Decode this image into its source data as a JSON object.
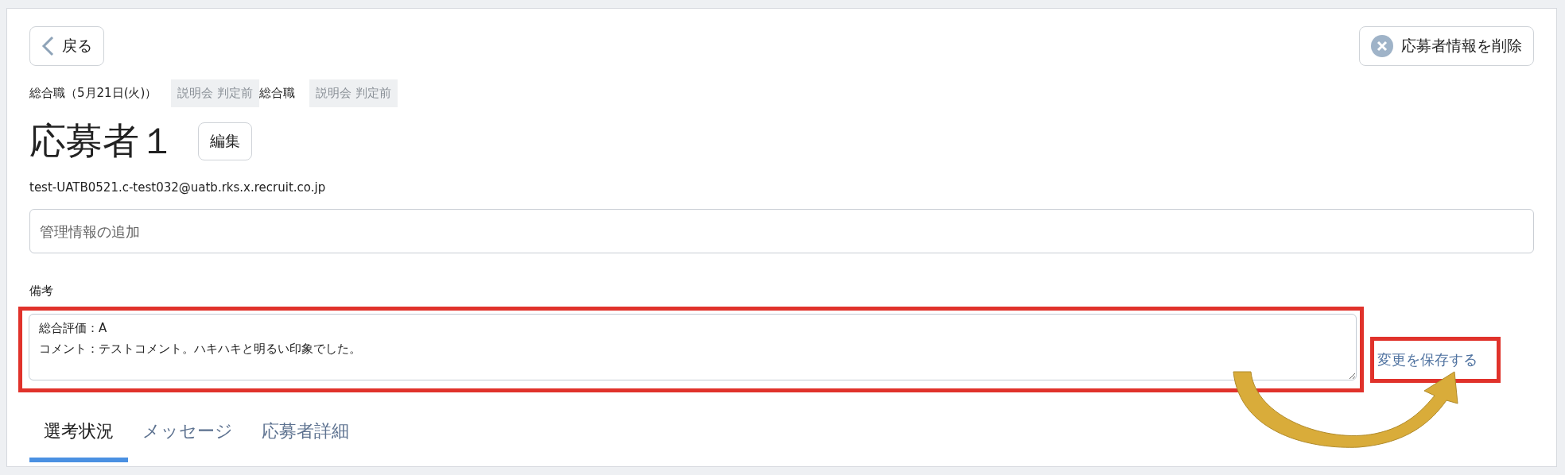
{
  "back_button": {
    "label": "戻る"
  },
  "delete_button": {
    "label": "応募者情報を削除"
  },
  "tags": [
    {
      "kind": "text",
      "label": "総合職（5月21日(火)）"
    },
    {
      "kind": "badge",
      "label": "説明会 判定前"
    },
    {
      "kind": "text",
      "label": "総合職"
    },
    {
      "kind": "badge",
      "label": "説明会 判定前"
    }
  ],
  "applicant": {
    "name": "応募者１",
    "edit_button": "編集",
    "email": "test-UATB0521.c-test032@uatb.rks.x.recruit.co.jp"
  },
  "management_field": {
    "placeholder": "管理情報の追加"
  },
  "notes": {
    "label": "備考",
    "value": "総合評価：A\nコメント：テストコメント。ハキハキと明るい印象でした。",
    "save_link": "変更を保存する"
  },
  "tabs": [
    {
      "label": "選考状況",
      "selected": true
    },
    {
      "label": "メッセージ",
      "selected": false
    },
    {
      "label": "応募者詳細",
      "selected": false
    }
  ]
}
